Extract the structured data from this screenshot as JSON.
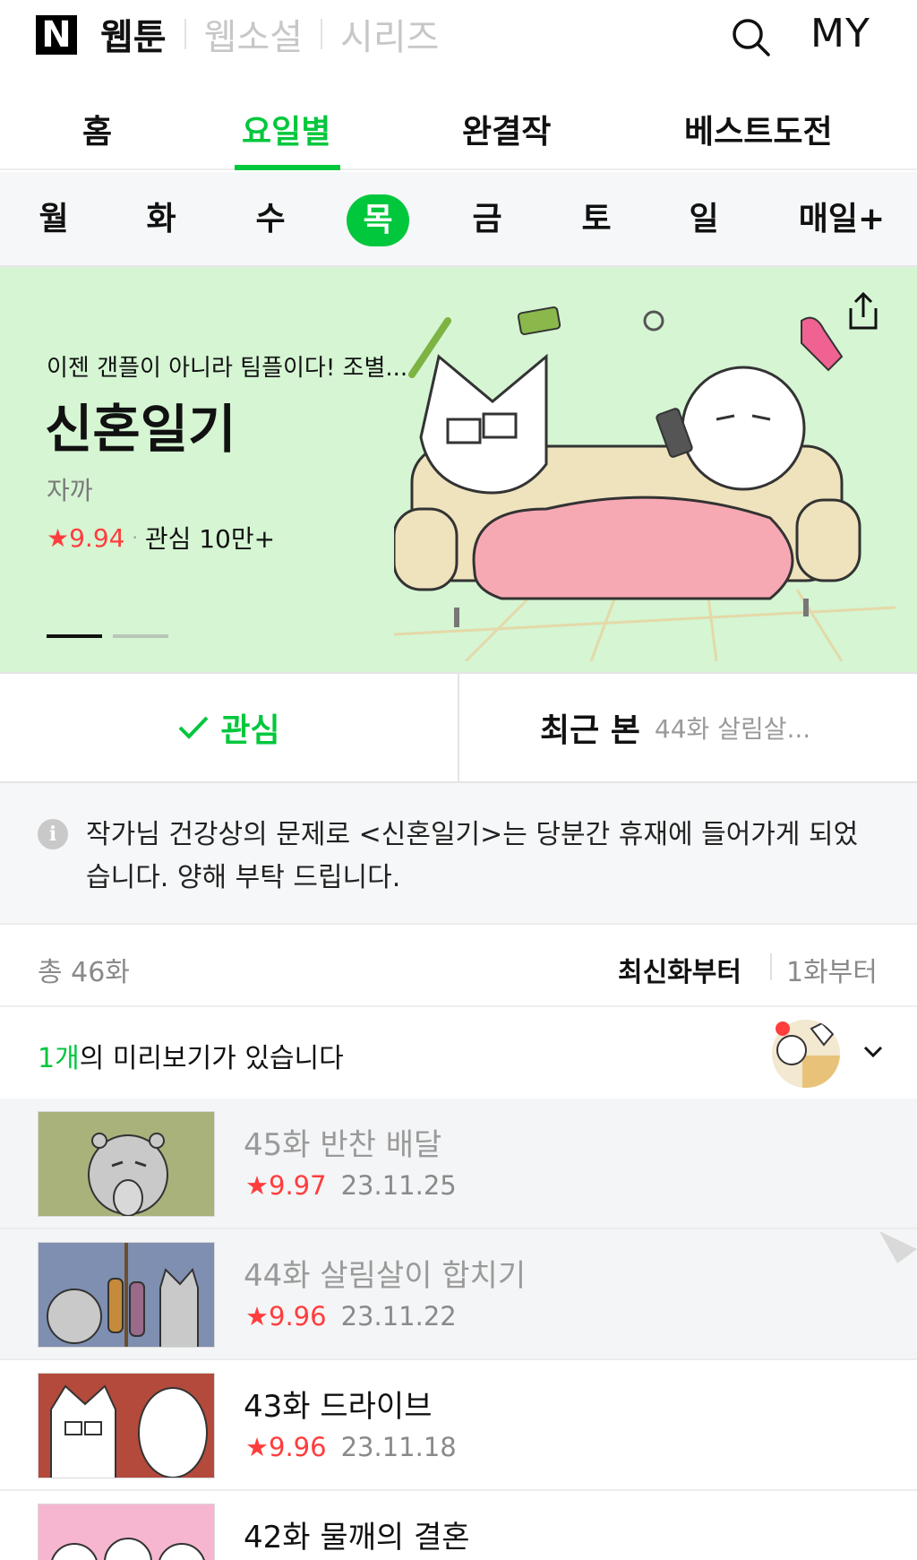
{
  "brand": {
    "logo": "N"
  },
  "top_tabs": [
    "웹툰",
    "웹소설",
    "시리즈"
  ],
  "header": {
    "my_label": "MY"
  },
  "main_nav": [
    "홈",
    "요일별",
    "완결작",
    "베스트도전"
  ],
  "days": [
    "월",
    "화",
    "수",
    "목",
    "금",
    "토",
    "일",
    "매일+"
  ],
  "banner": {
    "subtitle": "이젠 갠플이 아니라 팀플이다! 조별...",
    "title": "신혼일기",
    "author": "자까",
    "rating": "9.94",
    "interest": "관심 10만+"
  },
  "actions": {
    "fav_label": "관심",
    "recent_label": "최근 본",
    "recent_value": "44화 살림살..."
  },
  "notice": {
    "text": "작가님 건강상의 문제로 <신혼일기>는 당분간 휴재에 들어가게 되었습니다. 양해 부탁 드립니다."
  },
  "list_header": {
    "total": "총 46화",
    "sort_newest": "최신화부터",
    "sort_first": "1화부터"
  },
  "preview": {
    "count": "1개",
    "text": "의 미리보기가 있습니다"
  },
  "episodes": [
    {
      "title": "45화 반찬 배달",
      "rating": "9.97",
      "date": "23.11.25"
    },
    {
      "title": "44화 살림살이 합치기",
      "rating": "9.96",
      "date": "23.11.22"
    },
    {
      "title": "43화 드라이브",
      "rating": "9.96",
      "date": "23.11.18"
    },
    {
      "title": "42화 물깨의 결혼"
    }
  ],
  "colors": {
    "accent": "#00c73c",
    "rating": "#ff3d3d",
    "banner_bg": "#d5f5d3"
  },
  "icons": [
    "search-icon",
    "share-icon",
    "check-icon",
    "info-icon",
    "chevron-down-icon",
    "star-icon"
  ]
}
